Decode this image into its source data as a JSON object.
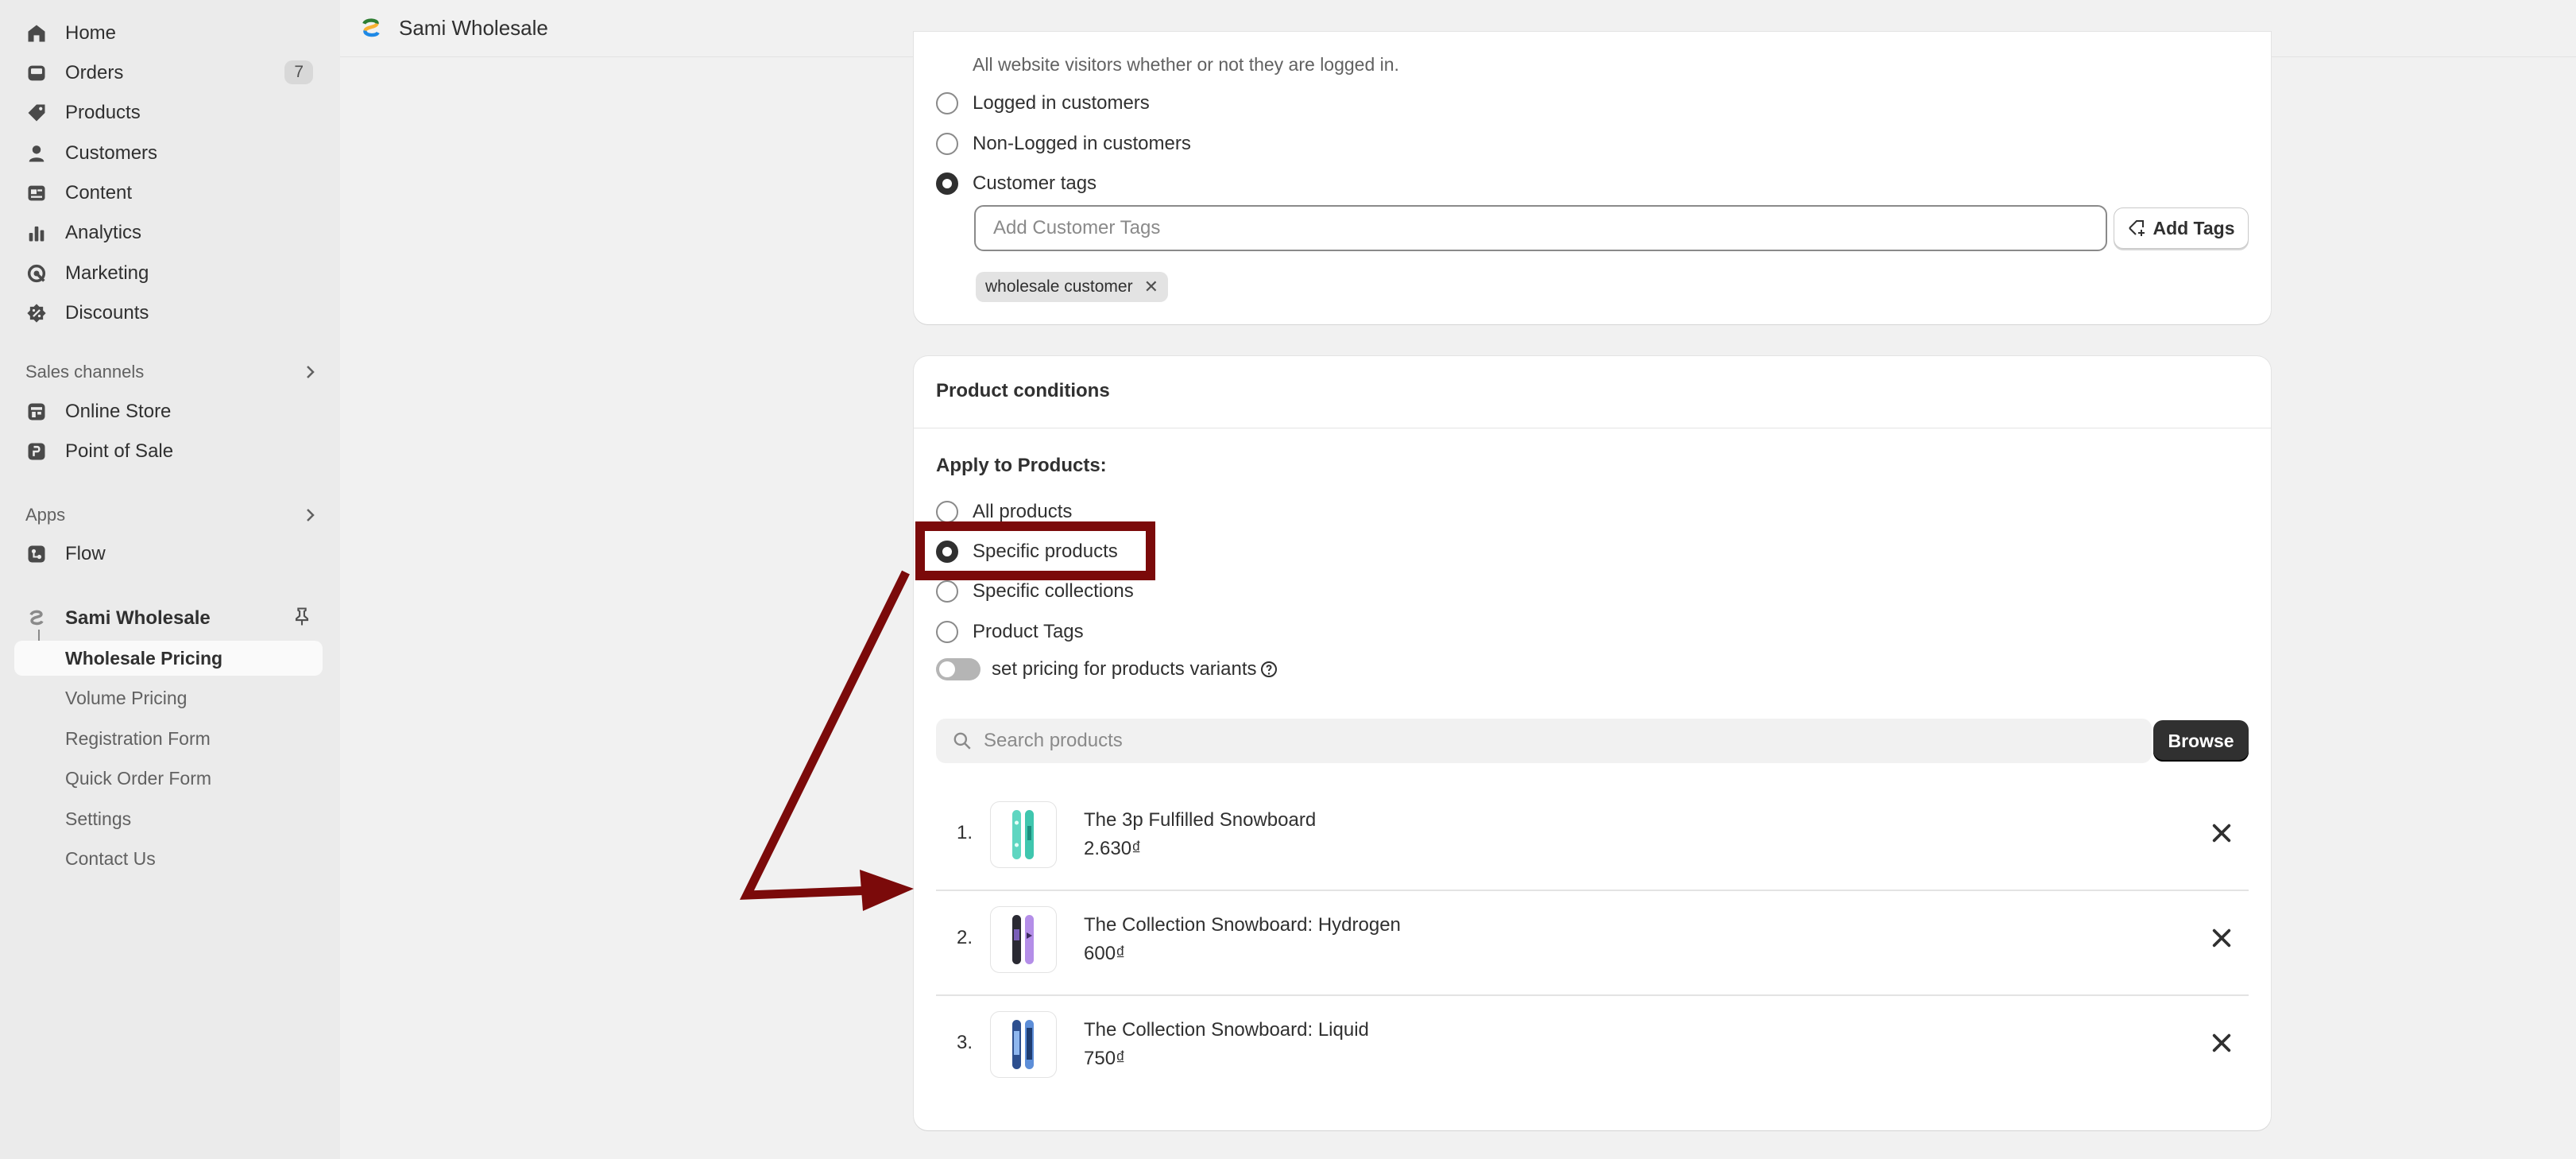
{
  "sidebar": {
    "nav": [
      {
        "label": "Home",
        "icon": "home-icon"
      },
      {
        "label": "Orders",
        "icon": "orders-icon",
        "badge": "7"
      },
      {
        "label": "Products",
        "icon": "tag-icon"
      },
      {
        "label": "Customers",
        "icon": "person-icon"
      },
      {
        "label": "Content",
        "icon": "content-icon"
      },
      {
        "label": "Analytics",
        "icon": "bar-chart-icon"
      },
      {
        "label": "Marketing",
        "icon": "target-icon"
      },
      {
        "label": "Discounts",
        "icon": "discount-icon"
      }
    ],
    "sales_channels_label": "Sales channels",
    "channels": [
      {
        "label": "Online Store",
        "icon": "store-icon"
      },
      {
        "label": "Point of Sale",
        "icon": "pos-icon"
      }
    ],
    "apps_label": "Apps",
    "apps": [
      {
        "label": "Flow",
        "icon": "flow-icon"
      }
    ],
    "app_name": "Sami Wholesale",
    "app_subitems": [
      {
        "label": "Wholesale Pricing",
        "active": true
      },
      {
        "label": "Volume Pricing"
      },
      {
        "label": "Registration Form"
      },
      {
        "label": "Quick Order Form"
      },
      {
        "label": "Settings"
      },
      {
        "label": "Contact Us"
      }
    ]
  },
  "topbar": {
    "title": "Sami Wholesale"
  },
  "customer_card": {
    "all_visitors_desc": "All website visitors whether or not they are logged in.",
    "options": [
      {
        "label": "Logged in customers",
        "checked": false
      },
      {
        "label": "Non-Logged in customers",
        "checked": false
      },
      {
        "label": "Customer tags",
        "checked": true
      }
    ],
    "tag_input_placeholder": "Add Customer Tags",
    "add_tags_label": "Add Tags",
    "tags": [
      "wholesale customer"
    ]
  },
  "product_card": {
    "title": "Product conditions",
    "apply_label": "Apply to Products:",
    "options": [
      {
        "label": "All products",
        "checked": false
      },
      {
        "label": "Specific products",
        "checked": true
      },
      {
        "label": "Specific collections",
        "checked": false
      },
      {
        "label": "Product Tags",
        "checked": false
      }
    ],
    "variants_toggle_label": "set pricing for products variants",
    "variants_toggle_on": false,
    "search_placeholder": "Search products",
    "browse_label": "Browse",
    "products": [
      {
        "num": "1.",
        "name": "The 3p Fulfilled Snowboard",
        "price": "2.630₫"
      },
      {
        "num": "2.",
        "name": "The Collection Snowboard: Hydrogen",
        "price": "600₫"
      },
      {
        "num": "3.",
        "name": "The Collection Snowboard: Liquid",
        "price": "750₫"
      }
    ]
  },
  "colors": {
    "annotation": "#7b0a0a",
    "sidebar_bg": "#ebebeb",
    "page_bg": "#f1f1f1",
    "primary_button": "#303030"
  }
}
